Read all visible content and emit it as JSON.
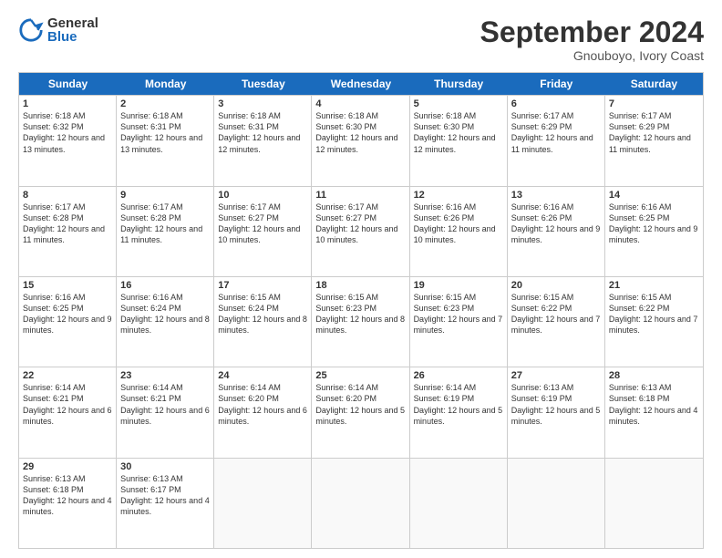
{
  "header": {
    "logo_general": "General",
    "logo_blue": "Blue",
    "month_title": "September 2024",
    "location": "Gnouboyo, Ivory Coast"
  },
  "days_of_week": [
    "Sunday",
    "Monday",
    "Tuesday",
    "Wednesday",
    "Thursday",
    "Friday",
    "Saturday"
  ],
  "weeks": [
    [
      {
        "day": 1,
        "sunrise": "6:18 AM",
        "sunset": "6:32 PM",
        "daylight": "Daylight: 12 hours and 13 minutes."
      },
      {
        "day": 2,
        "sunrise": "6:18 AM",
        "sunset": "6:31 PM",
        "daylight": "Daylight: 12 hours and 13 minutes."
      },
      {
        "day": 3,
        "sunrise": "6:18 AM",
        "sunset": "6:31 PM",
        "daylight": "Daylight: 12 hours and 12 minutes."
      },
      {
        "day": 4,
        "sunrise": "6:18 AM",
        "sunset": "6:30 PM",
        "daylight": "Daylight: 12 hours and 12 minutes."
      },
      {
        "day": 5,
        "sunrise": "6:18 AM",
        "sunset": "6:30 PM",
        "daylight": "Daylight: 12 hours and 12 minutes."
      },
      {
        "day": 6,
        "sunrise": "6:17 AM",
        "sunset": "6:29 PM",
        "daylight": "Daylight: 12 hours and 11 minutes."
      },
      {
        "day": 7,
        "sunrise": "6:17 AM",
        "sunset": "6:29 PM",
        "daylight": "Daylight: 12 hours and 11 minutes."
      }
    ],
    [
      {
        "day": 8,
        "sunrise": "6:17 AM",
        "sunset": "6:28 PM",
        "daylight": "Daylight: 12 hours and 11 minutes."
      },
      {
        "day": 9,
        "sunrise": "6:17 AM",
        "sunset": "6:28 PM",
        "daylight": "Daylight: 12 hours and 11 minutes."
      },
      {
        "day": 10,
        "sunrise": "6:17 AM",
        "sunset": "6:27 PM",
        "daylight": "Daylight: 12 hours and 10 minutes."
      },
      {
        "day": 11,
        "sunrise": "6:17 AM",
        "sunset": "6:27 PM",
        "daylight": "Daylight: 12 hours and 10 minutes."
      },
      {
        "day": 12,
        "sunrise": "6:16 AM",
        "sunset": "6:26 PM",
        "daylight": "Daylight: 12 hours and 10 minutes."
      },
      {
        "day": 13,
        "sunrise": "6:16 AM",
        "sunset": "6:26 PM",
        "daylight": "Daylight: 12 hours and 9 minutes."
      },
      {
        "day": 14,
        "sunrise": "6:16 AM",
        "sunset": "6:25 PM",
        "daylight": "Daylight: 12 hours and 9 minutes."
      }
    ],
    [
      {
        "day": 15,
        "sunrise": "6:16 AM",
        "sunset": "6:25 PM",
        "daylight": "Daylight: 12 hours and 9 minutes."
      },
      {
        "day": 16,
        "sunrise": "6:16 AM",
        "sunset": "6:24 PM",
        "daylight": "Daylight: 12 hours and 8 minutes."
      },
      {
        "day": 17,
        "sunrise": "6:15 AM",
        "sunset": "6:24 PM",
        "daylight": "Daylight: 12 hours and 8 minutes."
      },
      {
        "day": 18,
        "sunrise": "6:15 AM",
        "sunset": "6:23 PM",
        "daylight": "Daylight: 12 hours and 8 minutes."
      },
      {
        "day": 19,
        "sunrise": "6:15 AM",
        "sunset": "6:23 PM",
        "daylight": "Daylight: 12 hours and 7 minutes."
      },
      {
        "day": 20,
        "sunrise": "6:15 AM",
        "sunset": "6:22 PM",
        "daylight": "Daylight: 12 hours and 7 minutes."
      },
      {
        "day": 21,
        "sunrise": "6:15 AM",
        "sunset": "6:22 PM",
        "daylight": "Daylight: 12 hours and 7 minutes."
      }
    ],
    [
      {
        "day": 22,
        "sunrise": "6:14 AM",
        "sunset": "6:21 PM",
        "daylight": "Daylight: 12 hours and 6 minutes."
      },
      {
        "day": 23,
        "sunrise": "6:14 AM",
        "sunset": "6:21 PM",
        "daylight": "Daylight: 12 hours and 6 minutes."
      },
      {
        "day": 24,
        "sunrise": "6:14 AM",
        "sunset": "6:20 PM",
        "daylight": "Daylight: 12 hours and 6 minutes."
      },
      {
        "day": 25,
        "sunrise": "6:14 AM",
        "sunset": "6:20 PM",
        "daylight": "Daylight: 12 hours and 5 minutes."
      },
      {
        "day": 26,
        "sunrise": "6:14 AM",
        "sunset": "6:19 PM",
        "daylight": "Daylight: 12 hours and 5 minutes."
      },
      {
        "day": 27,
        "sunrise": "6:13 AM",
        "sunset": "6:19 PM",
        "daylight": "Daylight: 12 hours and 5 minutes."
      },
      {
        "day": 28,
        "sunrise": "6:13 AM",
        "sunset": "6:18 PM",
        "daylight": "Daylight: 12 hours and 4 minutes."
      }
    ],
    [
      {
        "day": 29,
        "sunrise": "6:13 AM",
        "sunset": "6:18 PM",
        "daylight": "Daylight: 12 hours and 4 minutes."
      },
      {
        "day": 30,
        "sunrise": "6:13 AM",
        "sunset": "6:17 PM",
        "daylight": "Daylight: 12 hours and 4 minutes."
      },
      null,
      null,
      null,
      null,
      null
    ]
  ]
}
